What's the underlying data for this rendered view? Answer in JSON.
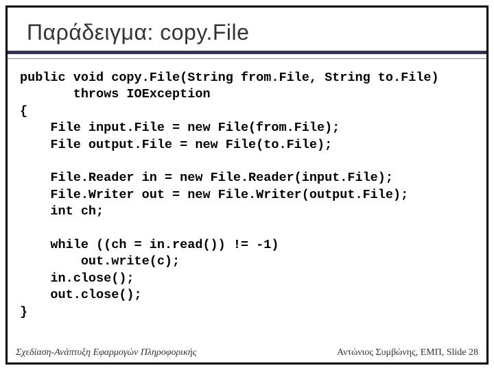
{
  "title": "Παράδειγμα: copy.File",
  "code": "public void copy.File(String from.File, String to.File)\n       throws IOException\n{\n    File input.File = new File(from.File);\n    File output.File = new File(to.File);\n\n    File.Reader in = new File.Reader(input.File);\n    File.Writer out = new File.Writer(output.File);\n    int ch;\n\n    while ((ch = in.read()) != -1)\n        out.write(c);\n    in.close();\n    out.close();\n}",
  "footer": {
    "left": "Σχεδίαση-Ανάπτυξη Εφαρμογών Πληροφορικής",
    "right": "Αντώνιος Συμβώνης, ΕΜΠ, Slide 28"
  }
}
